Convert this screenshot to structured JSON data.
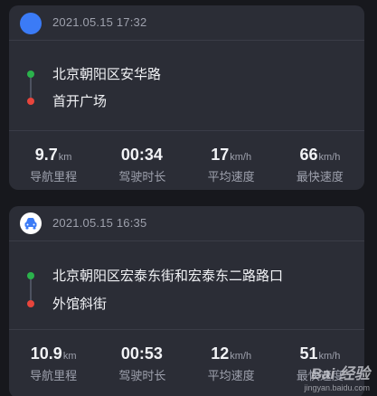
{
  "trips": [
    {
      "time": "2021.05.15 17:32",
      "start": "北京朝阳区安华路",
      "end": "首开广场",
      "stats": [
        {
          "value": "9.7",
          "unit": "km",
          "label": "导航里程"
        },
        {
          "value": "00:34",
          "unit": "",
          "label": "驾驶时长"
        },
        {
          "value": "17",
          "unit": "km/h",
          "label": "平均速度"
        },
        {
          "value": "66",
          "unit": "km/h",
          "label": "最快速度"
        }
      ]
    },
    {
      "time": "2021.05.15 16:35",
      "start": "北京朝阳区宏泰东街和宏泰东二路路口",
      "end": "外馆斜街",
      "stats": [
        {
          "value": "10.9",
          "unit": "km",
          "label": "导航里程"
        },
        {
          "value": "00:53",
          "unit": "",
          "label": "驾驶时长"
        },
        {
          "value": "12",
          "unit": "km/h",
          "label": "平均速度"
        },
        {
          "value": "51",
          "unit": "km/h",
          "label": "最快速度"
        }
      ]
    }
  ],
  "watermark": {
    "main": "Bai 经验",
    "url": "jingyan.baidu.com"
  },
  "icons": {
    "trip1_avatar": "blue-circle-avatar-icon",
    "trip2_avatar": "car-icon"
  },
  "colors": {
    "background": "#17181d",
    "card": "#2b2d36",
    "start_dot": "#2bb24c",
    "end_dot": "#e8453c",
    "avatar_blue": "#3b7bf6"
  }
}
